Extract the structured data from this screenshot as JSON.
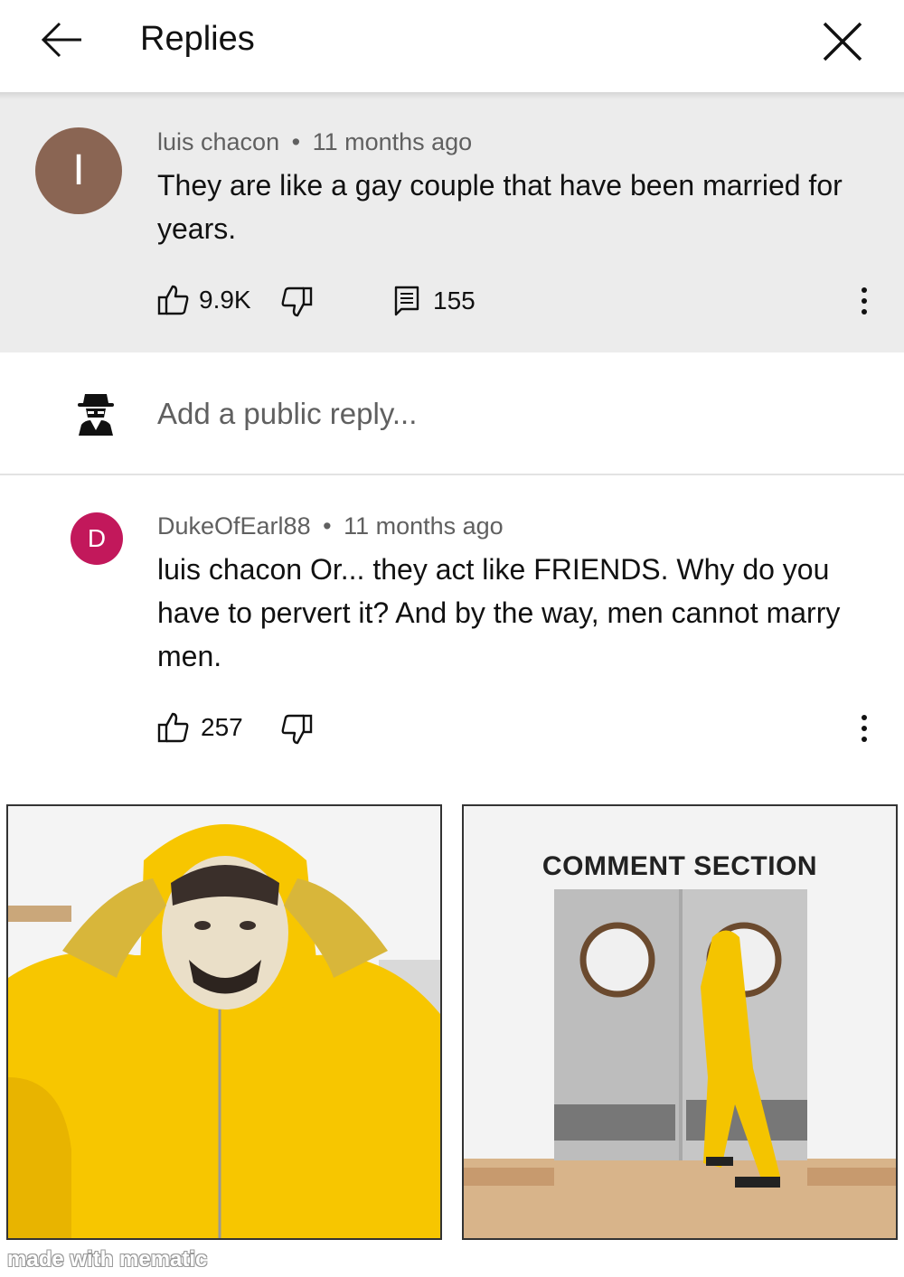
{
  "header": {
    "title": "Replies",
    "back_icon": "arrow-left-icon",
    "close_icon": "close-icon"
  },
  "parent_comment": {
    "avatar_letter": "I",
    "avatar_color": "#8a6553",
    "author": "luis chacon",
    "separator": "•",
    "time": "11 months ago",
    "text": "They are like a gay couple that have been married for years.",
    "likes": "9.9K",
    "replies": "155"
  },
  "reply_box": {
    "placeholder": "Add a public reply...",
    "avatar_icon": "incognito-spy-icon"
  },
  "reply_comment": {
    "avatar_letter": "D",
    "avatar_color": "#c2185b",
    "author": "DukeOfEarl88",
    "separator": "•",
    "time": "11 months ago",
    "text": "luis chacon Or... they act like FRIENDS.  Why do you have to pervert it?  And by the way, men cannot marry men.",
    "likes": "257"
  },
  "meme": {
    "right_caption": "COMMENT SECTION",
    "watermark": "made with mematic"
  }
}
